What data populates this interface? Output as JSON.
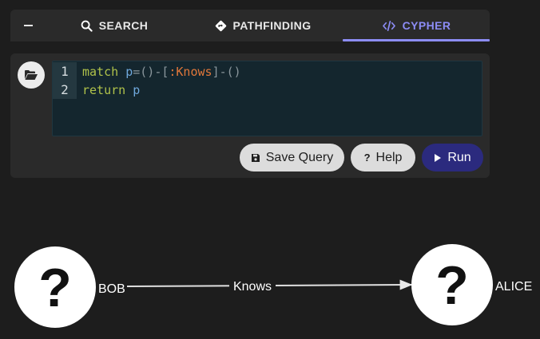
{
  "tabs": {
    "search": "SEARCH",
    "pathfinding": "PATHFINDING",
    "cypher": "CYPHER"
  },
  "active_tab": "CYPHER",
  "editor": {
    "line_numbers": [
      "1",
      "2"
    ],
    "line1": {
      "kw": "match",
      "var": "p",
      "eq": "=",
      "open": "()",
      "dash1": "-[",
      "colon": ":",
      "label": "Knows",
      "close": "]",
      "dash2": "-",
      "end": "()"
    },
    "line2": {
      "kw": "return",
      "var": "p"
    }
  },
  "buttons": {
    "save": "Save Query",
    "help": "Help",
    "help_icon": "?",
    "run": "Run"
  },
  "graph": {
    "nodes": [
      {
        "label": "BOB",
        "glyph": "?"
      },
      {
        "label": "ALICE",
        "glyph": "?"
      }
    ],
    "edge_label": "Knows"
  },
  "colors": {
    "background": "#1d1d1d",
    "panel": "#2a2a2a",
    "accent": "#8c8cf5",
    "run_button": "#2b2a7e"
  },
  "icons": [
    "minus-icon",
    "search-icon",
    "pathfinding-icon",
    "code-icon",
    "folder-open-icon",
    "save-icon",
    "help-icon",
    "play-icon"
  ]
}
